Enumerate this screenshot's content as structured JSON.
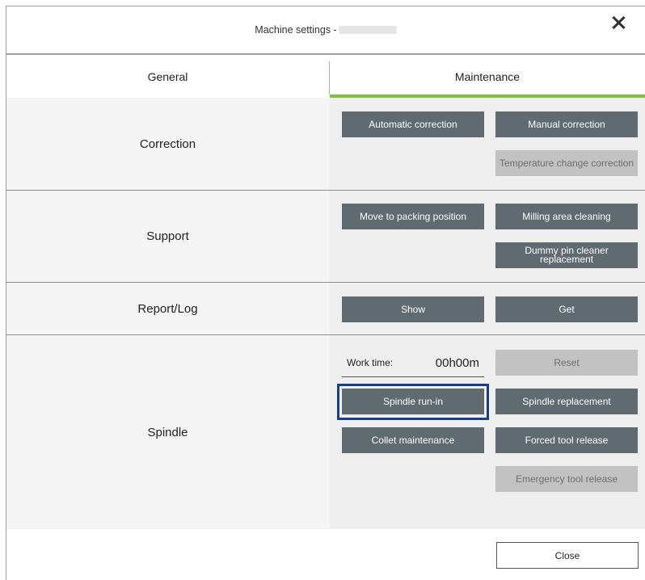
{
  "dialog": {
    "title": "Machine settings -",
    "close_icon": "close-x-icon"
  },
  "tabs": [
    {
      "label": "General",
      "active": false
    },
    {
      "label": "Maintenance",
      "active": true
    }
  ],
  "accent_color": "#7dc242",
  "sections": {
    "correction": {
      "label": "Correction",
      "automatic": "Automatic correction",
      "manual": "Manual correction",
      "temperature": "Temperature change correction"
    },
    "support": {
      "label": "Support",
      "packing": "Move to packing position",
      "cleaning": "Milling area cleaning",
      "dummy_pin_line1": "Dummy pin cleaner",
      "dummy_pin_line2": "replacement"
    },
    "report": {
      "label": "Report/Log",
      "show": "Show",
      "get": "Get"
    },
    "spindle": {
      "label": "Spindle",
      "work_time_label": "Work time:",
      "work_time_value": "00h00m",
      "reset": "Reset",
      "run_in": "Spindle run-in",
      "replacement": "Spindle replacement",
      "collet": "Collet maintenance",
      "forced_release": "Forced tool release",
      "emergency_release": "Emergency tool release"
    }
  },
  "footer": {
    "close_label": "Close"
  }
}
